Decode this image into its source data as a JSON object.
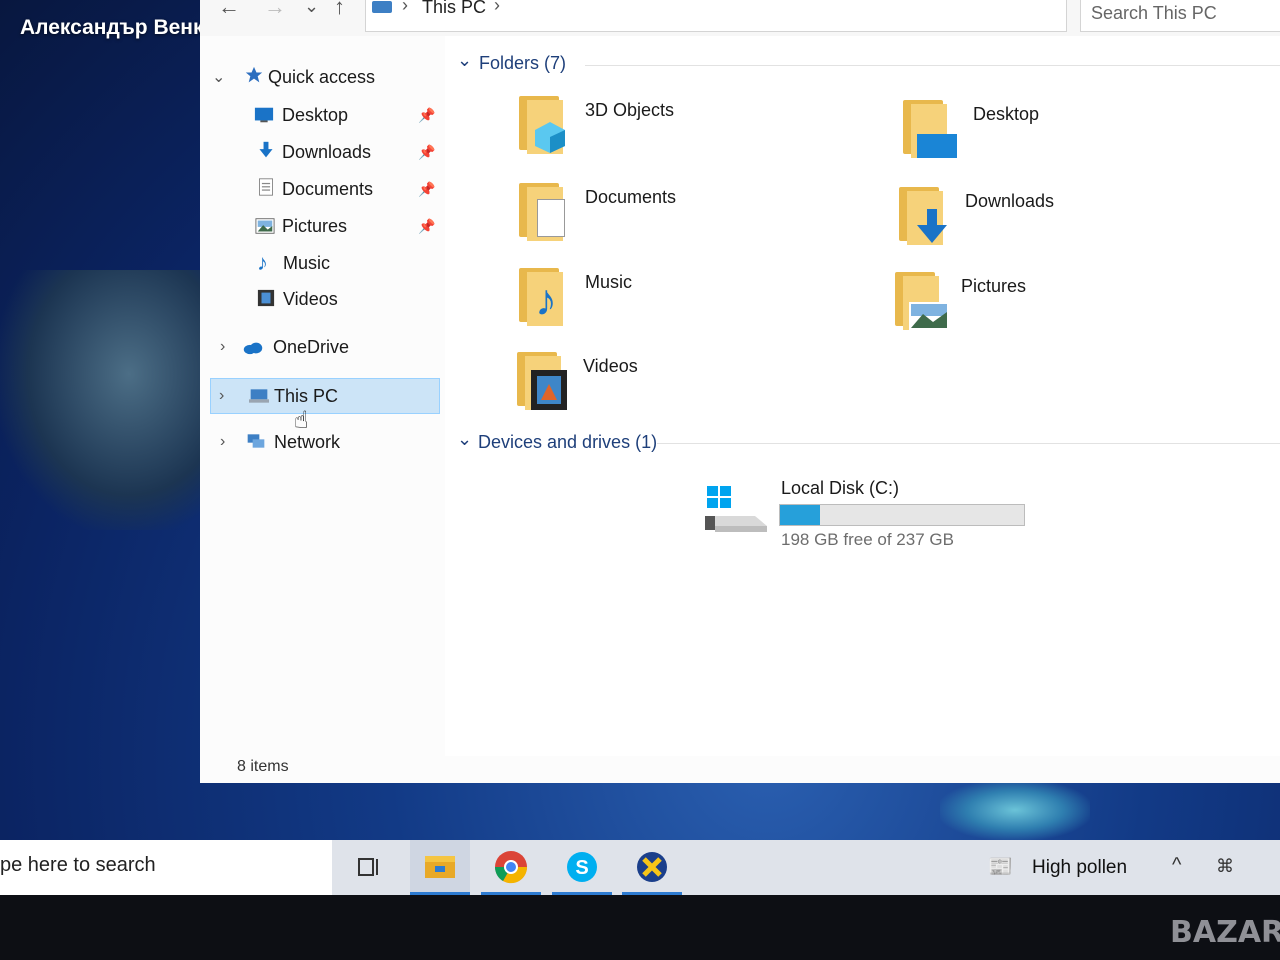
{
  "desktop": {
    "user_name": "Александър Венков"
  },
  "explorer": {
    "nav": {
      "back": "←",
      "forward": "→",
      "recent": "⌄",
      "up": "↑"
    },
    "address": {
      "path_segment": "This PC",
      "separator": "›"
    },
    "search_placeholder": "Search This PC",
    "sidebar": {
      "quick_access": "Quick access",
      "items": [
        {
          "label": "Desktop",
          "pinned": true
        },
        {
          "label": "Downloads",
          "pinned": true
        },
        {
          "label": "Documents",
          "pinned": true
        },
        {
          "label": "Pictures",
          "pinned": true
        },
        {
          "label": "Music",
          "pinned": false
        },
        {
          "label": "Videos",
          "pinned": false
        }
      ],
      "onedrive": "OneDrive",
      "this_pc": "This PC",
      "network": "Network"
    },
    "folders_header": "Folders (7)",
    "folders": [
      {
        "label": "3D Objects",
        "icon": "3d-objects-folder-icon"
      },
      {
        "label": "Desktop",
        "icon": "desktop-folder-icon"
      },
      {
        "label": "Documents",
        "icon": "documents-folder-icon"
      },
      {
        "label": "Downloads",
        "icon": "downloads-folder-icon"
      },
      {
        "label": "Music",
        "icon": "music-folder-icon"
      },
      {
        "label": "Pictures",
        "icon": "pictures-folder-icon"
      },
      {
        "label": "Videos",
        "icon": "videos-folder-icon"
      }
    ],
    "devices_header": "Devices and drives (1)",
    "drive": {
      "label": "Local Disk (C:)",
      "free_text": "198 GB free of 237 GB",
      "used_fraction": 0.165
    },
    "status": "8 items"
  },
  "taskbar": {
    "search_text": "pe here to search",
    "weather_text": "High pollen",
    "apps": [
      "task-view-icon",
      "file-explorer-icon",
      "chrome-icon",
      "skype-icon",
      "xming-icon"
    ]
  },
  "colors": {
    "accent": "#26a0da",
    "selection": "#cce4f7",
    "folder": "#f6d27a",
    "header": "#1e3f7a"
  },
  "watermark": "BAZAR"
}
